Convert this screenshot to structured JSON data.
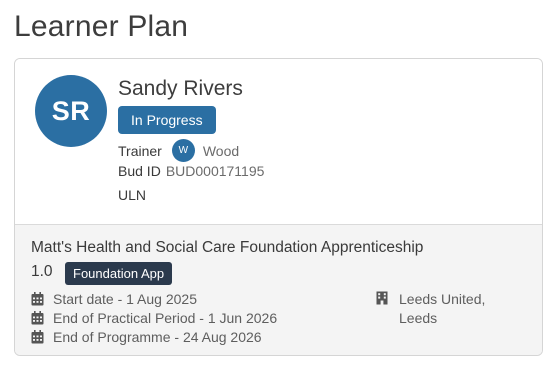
{
  "page": {
    "title": "Learner Plan"
  },
  "learner": {
    "initials": "SR",
    "name": "Sandy Rivers",
    "status": "In Progress",
    "trainer_label": "Trainer",
    "trainer_initial": "W",
    "trainer_name": "Wood",
    "bud_id_label": "Bud ID",
    "bud_id": "BUD000171195",
    "uln_label": "ULN",
    "uln": ""
  },
  "programme": {
    "title": "Matt's Health and Social Care Foundation Apprenticeship",
    "version": "1.0",
    "type_badge": "Foundation App",
    "start_date": "Start date - 1 Aug 2025",
    "practical_end": "End of Practical Period - 1 Jun 2026",
    "programme_end": "End of Programme - 24 Aug 2026",
    "location_line1": "Leeds United,",
    "location_line2": "Leeds"
  },
  "colors": {
    "primary": "#2b6fa3",
    "badge_dark": "#2b3a4d",
    "bottom_bg": "#f4f4f4"
  },
  "icons": {
    "date": "calendar-icon",
    "location": "building-icon"
  }
}
